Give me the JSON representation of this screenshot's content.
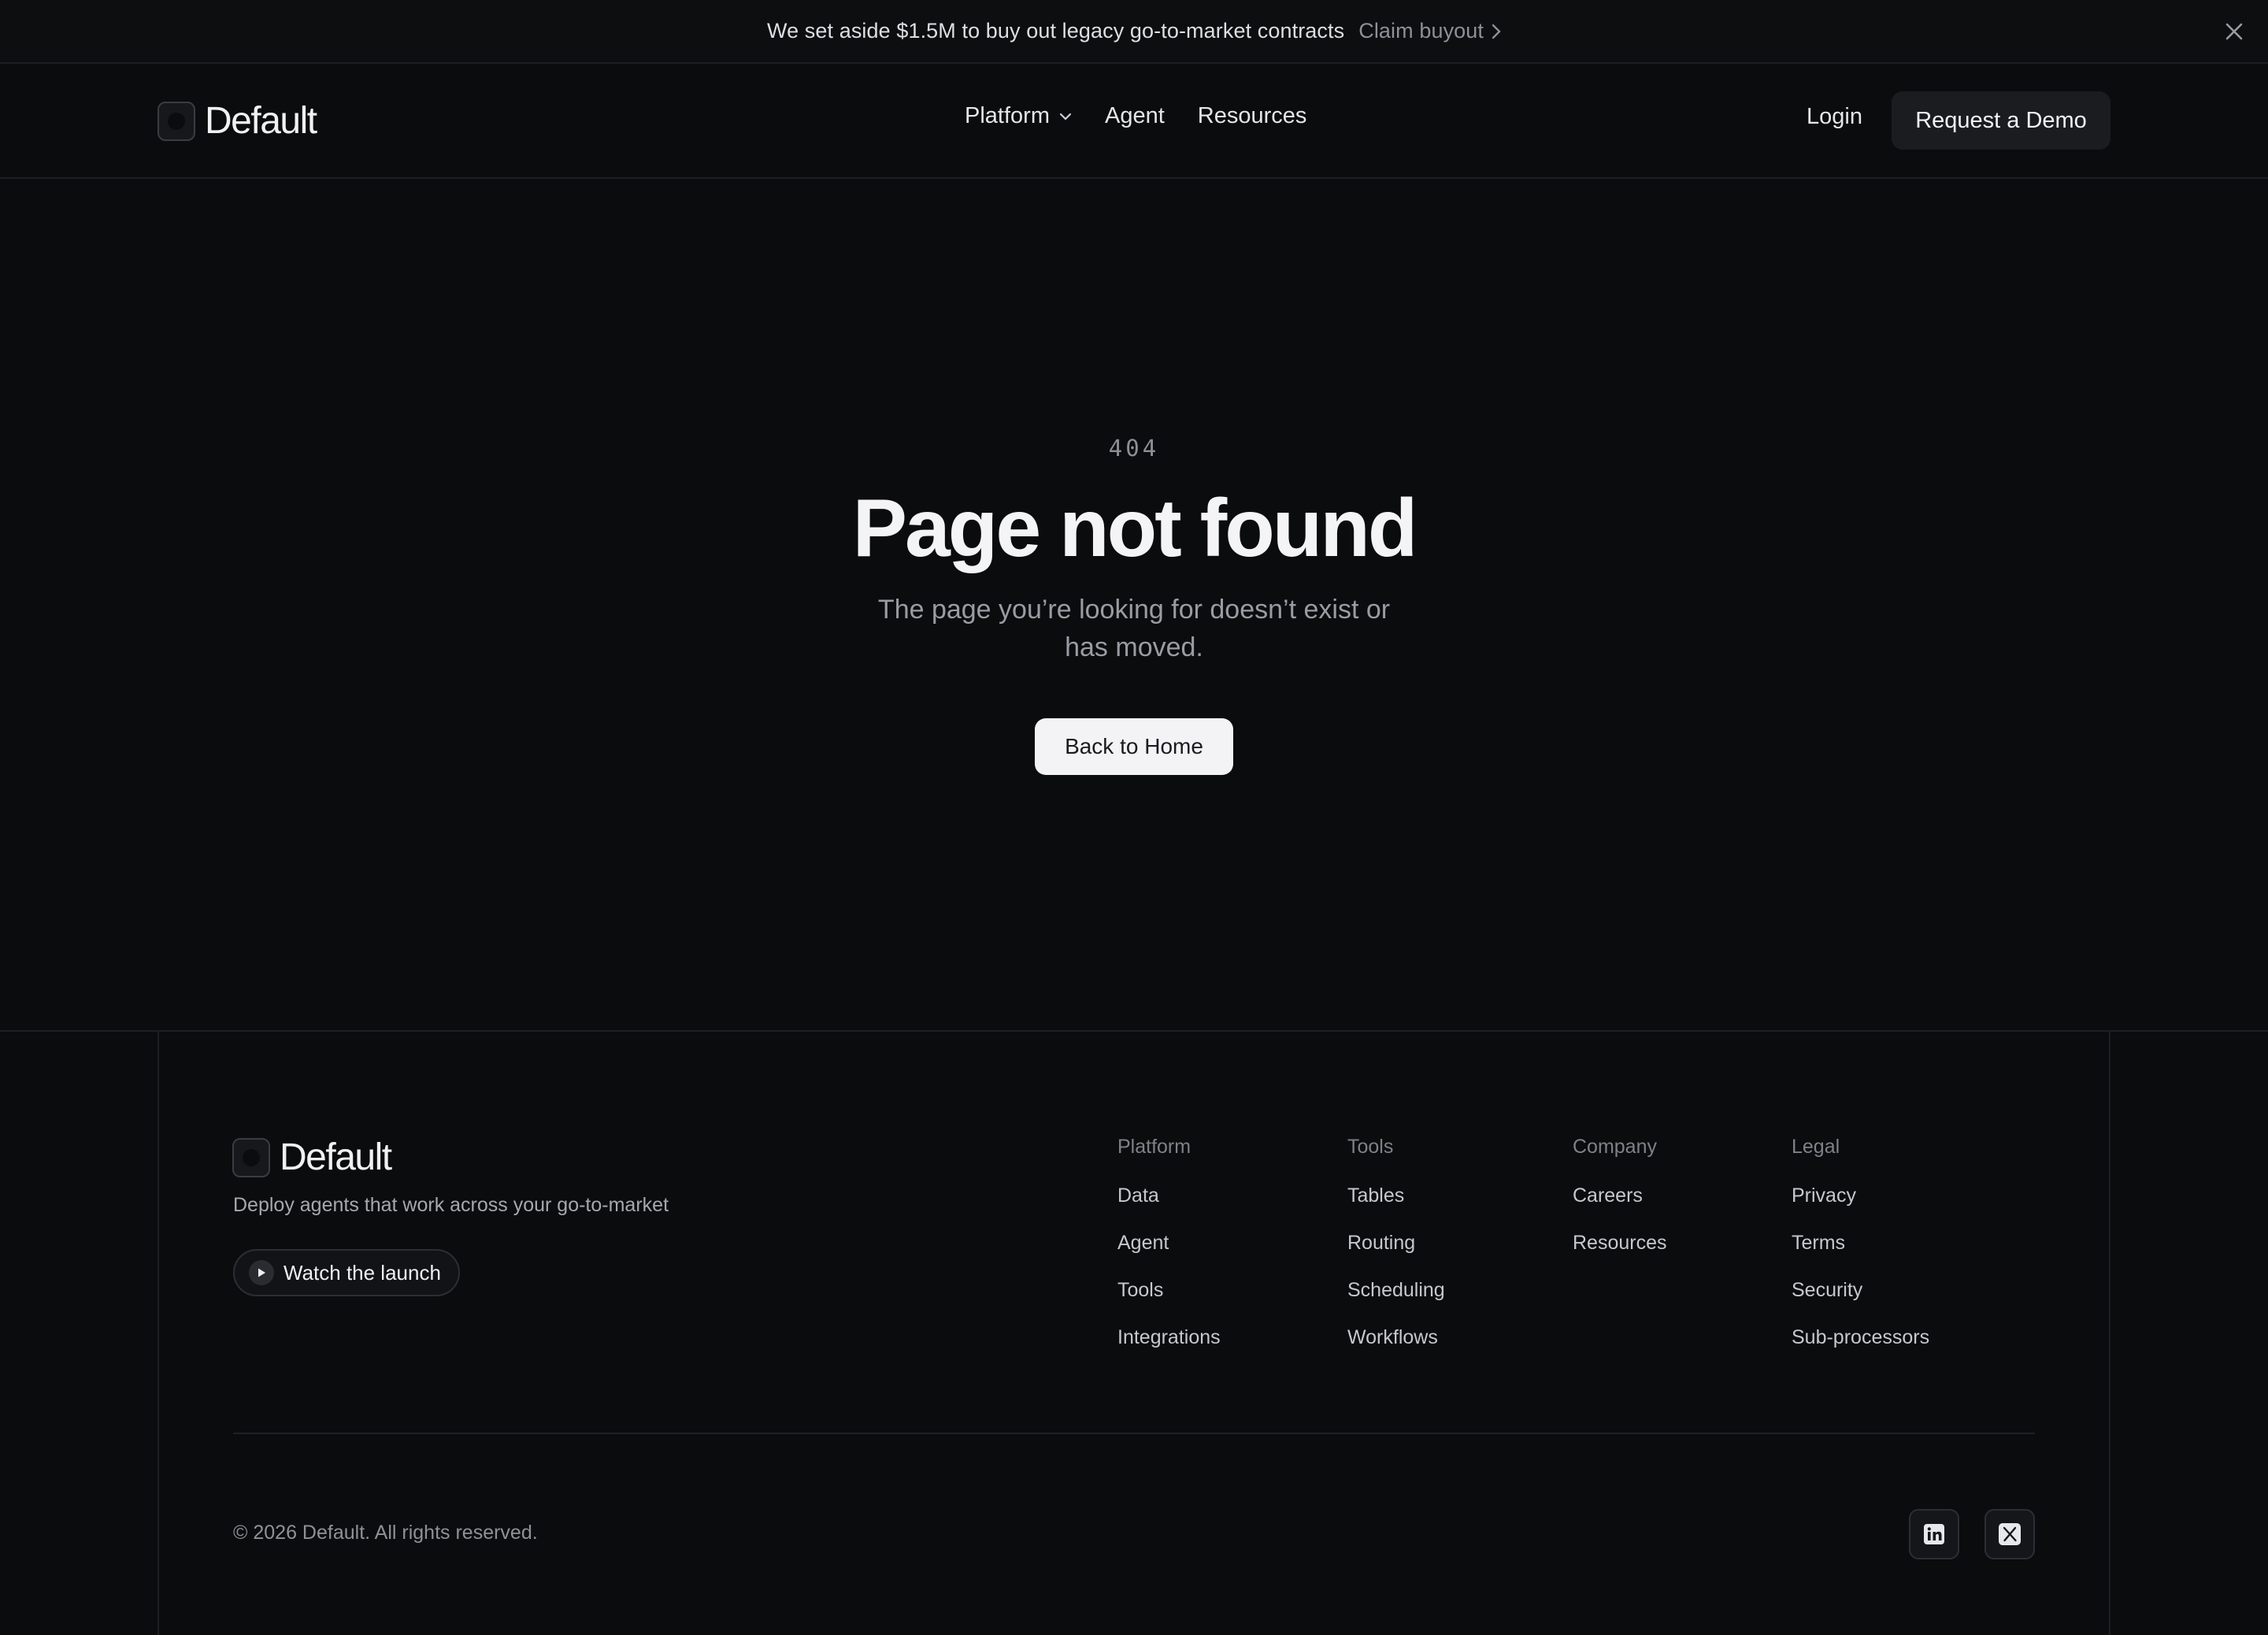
{
  "announcement": {
    "message": "We set aside $1.5M to buy out legacy go-to-market contracts",
    "cta": "Claim buyout"
  },
  "brand": {
    "name": "Default"
  },
  "nav": {
    "items": [
      {
        "label": "Platform",
        "has_dropdown": true
      },
      {
        "label": "Agent"
      },
      {
        "label": "Resources"
      }
    ],
    "login": "Login",
    "request_demo": "Request a Demo"
  },
  "error": {
    "code": "404",
    "title": "Page not found",
    "message": "The page you’re looking for doesn’t exist or has moved.",
    "back_button": "Back to Home"
  },
  "footer": {
    "tagline": "Deploy agents that work across your go-to-market",
    "watch_launch": "Watch the launch",
    "columns": [
      {
        "heading": "Platform",
        "links": [
          "Data",
          "Agent",
          "Tools",
          "Integrations"
        ]
      },
      {
        "heading": "Tools",
        "links": [
          "Tables",
          "Routing",
          "Scheduling",
          "Workflows"
        ]
      },
      {
        "heading": "Company",
        "links": [
          "Careers",
          "Resources"
        ]
      },
      {
        "heading": "Legal",
        "links": [
          "Privacy",
          "Terms",
          "Security",
          "Sub-processors"
        ]
      }
    ],
    "copyright": "© 2026 Default. All rights reserved.",
    "social": [
      "linkedin-icon",
      "x-icon"
    ]
  },
  "colors": {
    "background": "#0b0c0e",
    "primary_button_bg": "#f3f3f5",
    "secondary_button_bg": "#1b1c20",
    "muted_text": "#8f9197"
  }
}
